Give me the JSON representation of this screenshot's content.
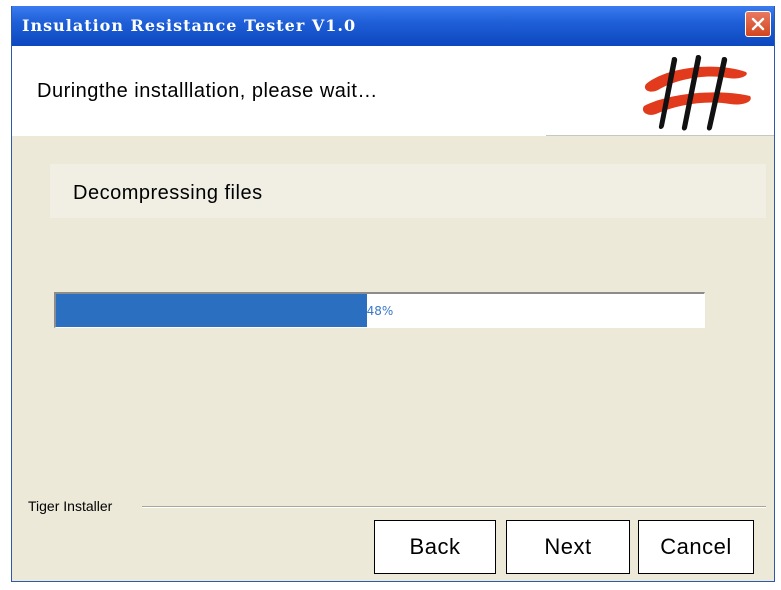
{
  "window": {
    "title": "Insulation Resistance Tester V1.0"
  },
  "header": {
    "message": "Duringthe installlation, please wait…"
  },
  "status": {
    "text": "Decompressing files"
  },
  "progress": {
    "percent": 48,
    "label": "48%"
  },
  "footer": {
    "installer_name": "Tiger Installer"
  },
  "buttons": {
    "back": "Back",
    "next": "Next",
    "cancel": "Cancel"
  },
  "colors": {
    "titlebar": "#1f5fd8",
    "progress_fill": "#2a6fc0",
    "window_bg": "#ece9d8",
    "close_button": "#d2461f",
    "logo_red": "#e23a1c"
  },
  "icons": {
    "close": "close-icon",
    "logo": "installer-logo"
  }
}
